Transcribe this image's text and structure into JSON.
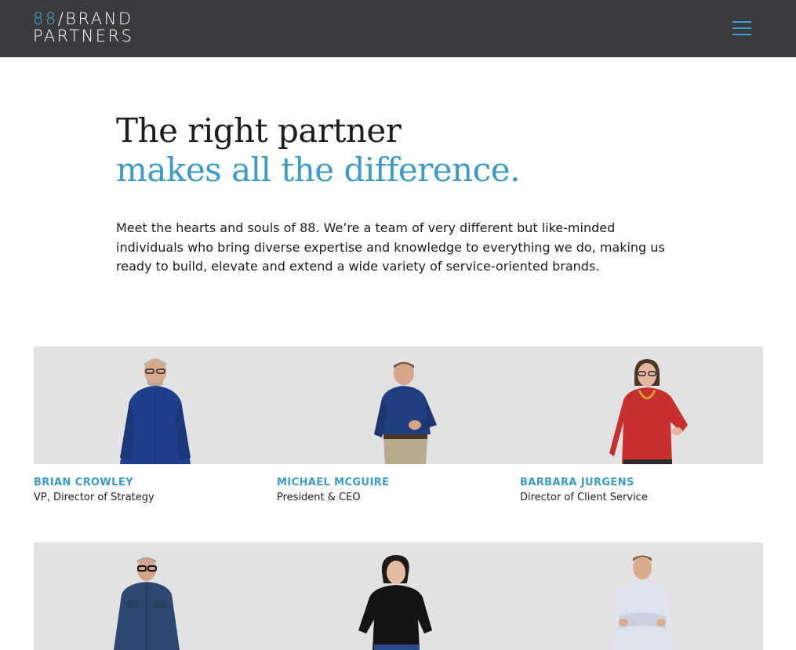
{
  "header": {
    "logo_number": "88",
    "logo_line1": "/BRAND",
    "logo_line2": "PARTNERS",
    "menu_icon": "hamburger-menu-icon",
    "accent_color": "#3aa0d4",
    "background_color": "#3b3b3d"
  },
  "hero": {
    "headline_line1": "The right partner",
    "headline_line2": "makes all the difference.",
    "intro": "Meet the hearts and souls of 88. We’re a team of very different but like-minded individuals who bring diverse expertise and knowledge to everything we do, making us ready to build, elevate and extend a wide variety of service-oriented brands.",
    "accent_color": "#3d9ac7"
  },
  "team": {
    "members": [
      {
        "name": "BRIAN CROWLEY",
        "role": "VP, Director of Strategy"
      },
      {
        "name": "MICHAEL MCGUIRE",
        "role": "President & CEO"
      },
      {
        "name": "BARBARA JURGENS",
        "role": "Director of Client Service"
      }
    ]
  }
}
